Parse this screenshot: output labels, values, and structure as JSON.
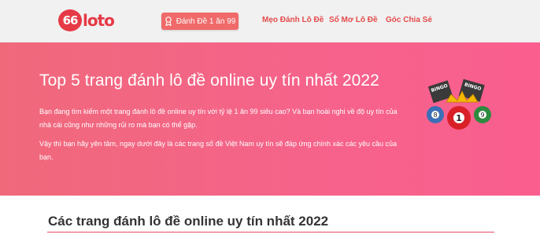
{
  "header": {
    "logo_badge": "66",
    "logo_text": "loto",
    "cta_label": "Đánh Đề 1 ăn 99",
    "nav": [
      "Mẹo Đánh Lô Đề",
      "Sổ Mơ Lô Đề",
      "Góc Chia Sẻ"
    ]
  },
  "hero": {
    "title": "Top 5 trang đánh lô đề online uy tín nhất 2022",
    "paragraph1": "Bạn đang tìm kiếm một trang đánh lô đề online uy tín với tỷ lệ 1 ăn 99 siêu cao? Và bạn hoài nghi về độ uy tín của nhà cái cũng như những rủi ro mà bạn có thể gặp.",
    "paragraph2": "Vậy thì bạn hãy yên tâm, ngay dưới đây là các trang số đề Việt Nam uy tín sẽ đáp ứng chính xác các yêu cầu của bạn.",
    "art": {
      "label1": "BINGO",
      "label2": "BINGO",
      "ball_left": "8",
      "ball_center": "1",
      "ball_right": "9"
    }
  },
  "section": {
    "title": "Các trang đánh lô đề online uy tín nhất 2022"
  },
  "colors": {
    "brand": "#e63946",
    "hero_start": "#f0697b",
    "hero_end": "#fa5e8f",
    "nav": "#e44b4b"
  }
}
